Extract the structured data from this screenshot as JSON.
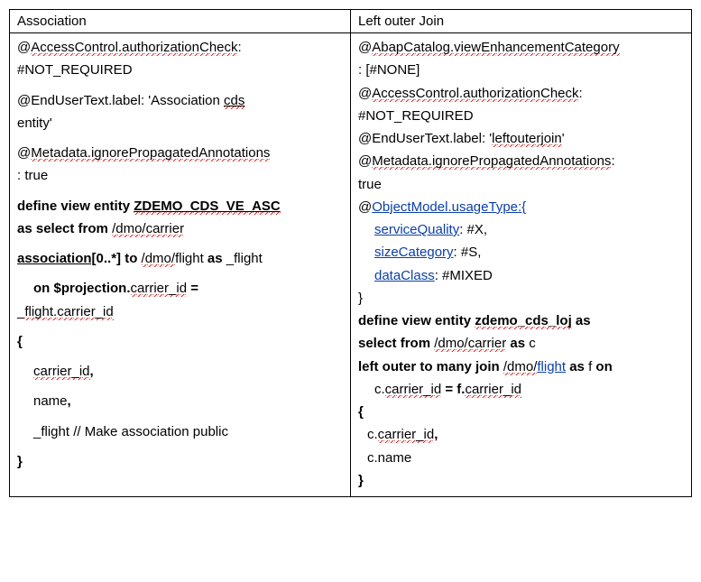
{
  "table": {
    "headers": {
      "left": "Association",
      "right": "Left outer Join"
    },
    "left": {
      "l1a": "@",
      "l1b": "AccessControl.authorizationCheck",
      "l1c": ":",
      "l2": "#NOT_REQUIRED",
      "l3": "@EndUserText.label: 'Association ",
      "l3_cds": "cds",
      "l4": "entity'",
      "l5a": "@",
      "l5b": "Metadata.ignorePropagatedAnnotations",
      "l6": ": true",
      "l7a": "define view entity ",
      "l7b": "ZDEMO_CDS_VE_ASC",
      "l8a": "as select from ",
      "l8b": "/dmo/carrier",
      "l9a": "association[",
      "l9b": "0..*] to ",
      "l9c": "/dmo/",
      "l9d": "flight",
      "l9e": " as",
      "l9f": " _flight",
      "l10a": "on $projection.",
      "l10b": "carrier_id",
      "l10c": " =",
      "l11a": "_",
      "l11b": "flight.carrier_id",
      "brace_open": "{",
      "f1": "carrier_id",
      "comma": ",",
      "f2": "name",
      "f3": "_flight // Make association public",
      "brace_close": "}"
    },
    "right": {
      "r1a": "@",
      "r1b": "AbapCatalog.viewEnhancementCategory",
      "r2": ": [#NONE]",
      "r3a": "@",
      "r3b": "AccessControl.authorizationCheck",
      "r3c": ":",
      "r4": "#NOT_REQUIRED",
      "r5a": "@EndUserText.label: '",
      "r5b": "leftouterjoin",
      "r5c": "'",
      "r6a": "@",
      "r6b": "Metadata.ignorePropagatedAnnotations",
      "r6c": ":",
      "r7": "true",
      "r8a": "@",
      "r8b": "ObjectModel.usageType:{",
      "r9a": "serviceQuality",
      "r9b": ": #X,",
      "r10a": "sizeCategory",
      "r10b": ": #S,",
      "r11a": "dataClass",
      "r11b": ": #MIXED",
      "r12": "}",
      "r13a": "define view entity ",
      "r13b": "zdemo_cds_loj",
      "r13c": " as",
      "r14a": "select from ",
      "r14b": "/dmo/carrier",
      "r14c": " as",
      "r14d": " c",
      "r15a": " left outer to many join ",
      "r15b": "/dmo/",
      "r15c": "flight",
      "r15d": " as",
      "r15e": " f ",
      "r15f": "on",
      "r16a": "c.",
      "r16b": "carrier_id",
      "r16c": " = f.",
      "r16d": "carrier_id",
      "r17": "{",
      "r18a": "c.",
      "r18b": "carrier_id",
      "r18c": ",",
      "r19": "c.name",
      "r20": "}"
    }
  }
}
